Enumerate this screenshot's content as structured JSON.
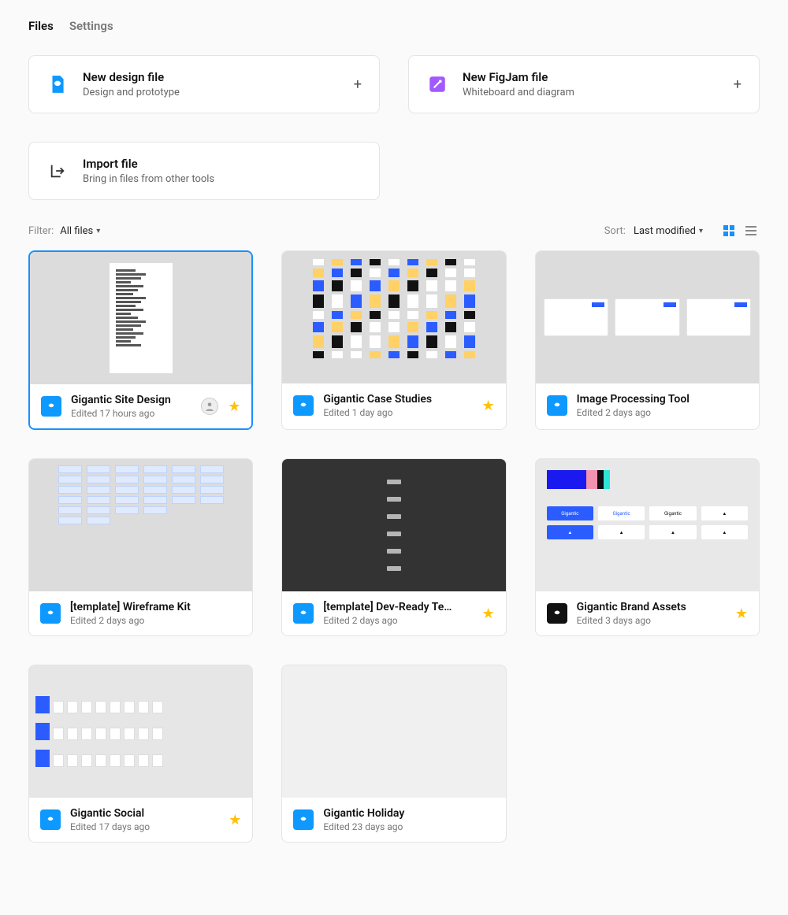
{
  "tabs": {
    "files": "Files",
    "settings": "Settings"
  },
  "actions": {
    "design": {
      "title": "New design file",
      "sub": "Design and prototype",
      "icon_color": "#0d99ff"
    },
    "figjam": {
      "title": "New FigJam file",
      "sub": "Whiteboard and diagram",
      "icon_color": "#a259ff"
    },
    "import": {
      "title": "Import file",
      "sub": "Bring in files from other tools"
    }
  },
  "toolbar": {
    "filter_label": "Filter:",
    "filter_value": "All files",
    "sort_label": "Sort:",
    "sort_value": "Last modified"
  },
  "files": [
    {
      "name": "Gigantic Site Design",
      "edited": "Edited 17 hours ago",
      "starred": true,
      "selected": true,
      "avatar": true,
      "icon": "blue",
      "thumb": "doc"
    },
    {
      "name": "Gigantic Case Studies",
      "edited": "Edited 1 day ago",
      "starred": true,
      "icon": "blue",
      "thumb": "strips"
    },
    {
      "name": "Image Processing Tool",
      "edited": "Edited 2 days ago",
      "starred": false,
      "icon": "blue",
      "thumb": "panels"
    },
    {
      "name": "[template] Wireframe Kit",
      "edited": "Edited 2 days ago",
      "starred": false,
      "icon": "blue",
      "thumb": "wire"
    },
    {
      "name": "[template] Dev-Ready Te…",
      "edited": "Edited 2 days ago",
      "starred": true,
      "icon": "blue",
      "thumb": "dark"
    },
    {
      "name": "Gigantic Brand Assets",
      "edited": "Edited 3 days ago",
      "starred": true,
      "icon": "black",
      "thumb": "brand"
    },
    {
      "name": "Gigantic Social",
      "edited": "Edited 17 days ago",
      "starred": true,
      "icon": "blue",
      "thumb": "social"
    },
    {
      "name": "Gigantic Holiday",
      "edited": "Edited 23 days ago",
      "starred": false,
      "icon": "blue",
      "thumb": "blank"
    }
  ],
  "colors": {
    "blue_icon": "#0d99ff",
    "black_icon": "#111111",
    "star": "#ffc107",
    "brand_palette": [
      "#1a1af0",
      "#f192b0",
      "#0e0e0e",
      "#2ee6d6"
    ]
  }
}
